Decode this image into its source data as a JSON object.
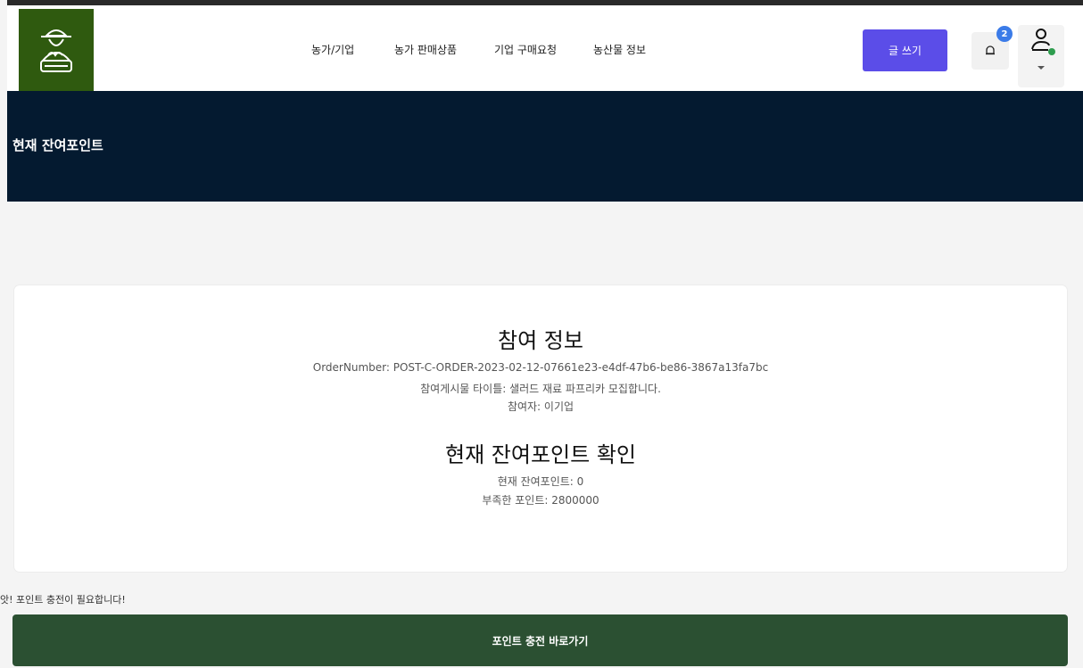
{
  "header": {
    "logo_icon": "farmer-logo-icon",
    "nav": [
      "농가/기업",
      "농가 판매상품",
      "기업 구매요청",
      "농산물 정보"
    ],
    "write_button": "글 쓰기",
    "notification_count": "2",
    "bell_icon": "bell-icon",
    "user_icon": "user-icon"
  },
  "hero": {
    "title": "현재 잔여포인트"
  },
  "card": {
    "participation_title": "참여 정보",
    "order_number": "OrderNumber: POST-C-ORDER-2023-02-12-07661e23-e4df-47b6-be86-3867a13fa7bc",
    "post_title": "참여게시물 타이틀: 샐러드 재료 파프리카 모집합니다.",
    "participant": "참여자: 이기업",
    "points_title": "현재 잔여포인트 확인",
    "current_points": "현재 잔여포인트: 0",
    "shortfall_points": "부족한 포인트: 2800000"
  },
  "notice": "앗! 포인트 충전이 필요합니다!",
  "charge_button": "포인트 충전 바로가기",
  "colors": {
    "logo_bg": "#2f5a0f",
    "hero_bg": "#041a30",
    "write_button_bg": "#5b4de8",
    "charge_button_bg": "#2b5032",
    "badge_bg": "#3b7be8",
    "status_dot": "#2e9d4e"
  }
}
